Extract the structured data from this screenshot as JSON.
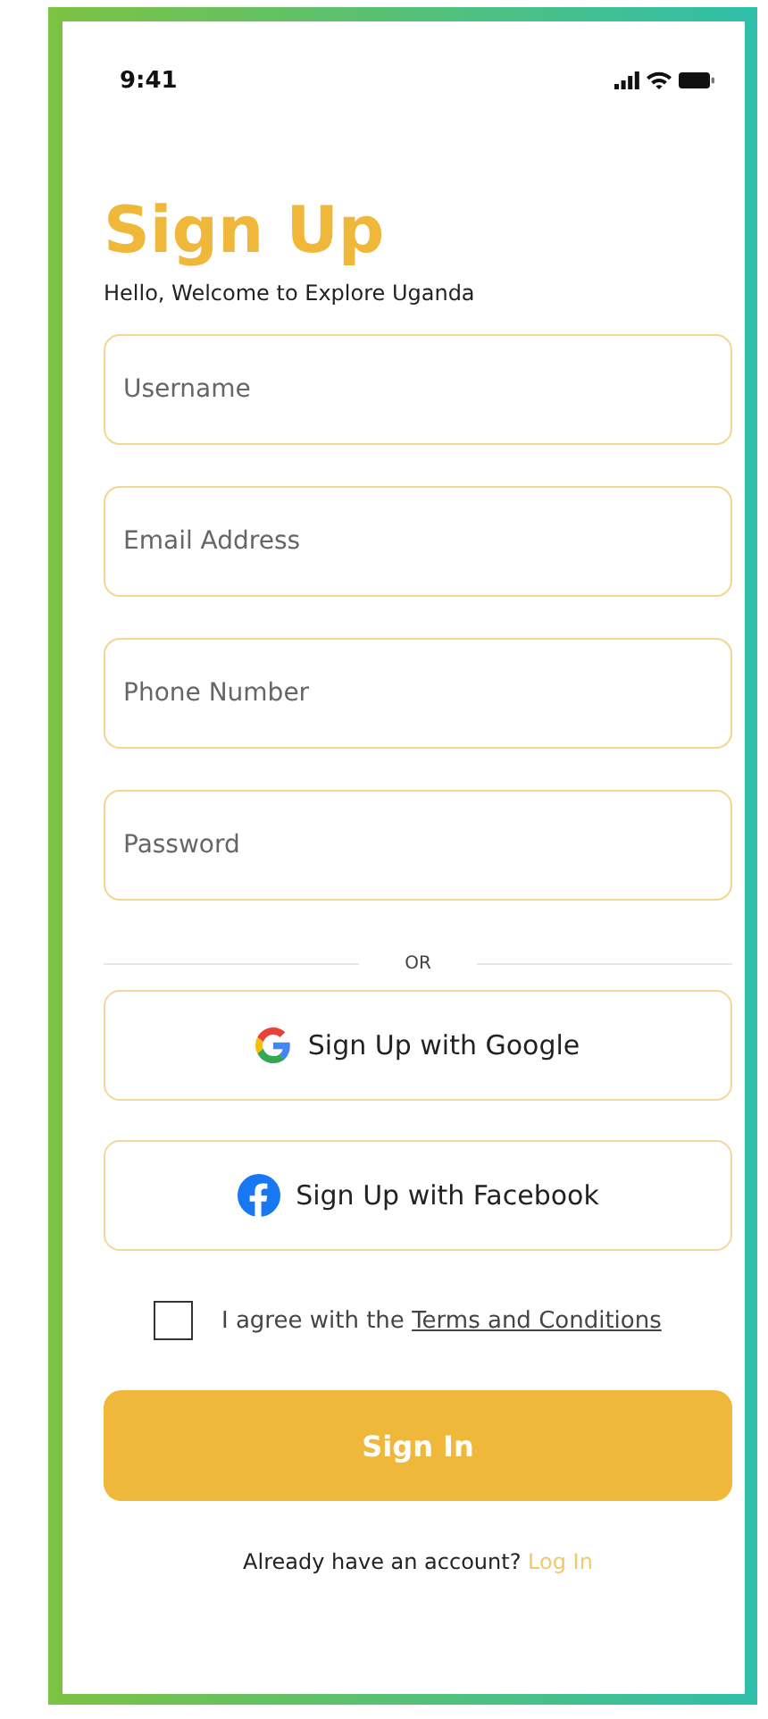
{
  "status_bar": {
    "time": "9:41"
  },
  "title": "Sign Up",
  "subtitle": "Hello, Welcome to Explore Uganda",
  "fields": [
    {
      "placeholder": "Username"
    },
    {
      "placeholder": "Email Address"
    },
    {
      "placeholder": "Phone Number"
    },
    {
      "placeholder": "Password"
    }
  ],
  "divider": "OR",
  "social_buttons": [
    {
      "label": "Sign Up with Google",
      "kind": "google"
    },
    {
      "label": "Sign Up with Facebook",
      "kind": "facebook"
    }
  ],
  "agreement": {
    "text": "I agree with the ",
    "link": "Terms and Conditions",
    "checked": false
  },
  "primary_button": "Sign In",
  "footer": {
    "text": "Already have an account? ",
    "link": "Log In"
  }
}
